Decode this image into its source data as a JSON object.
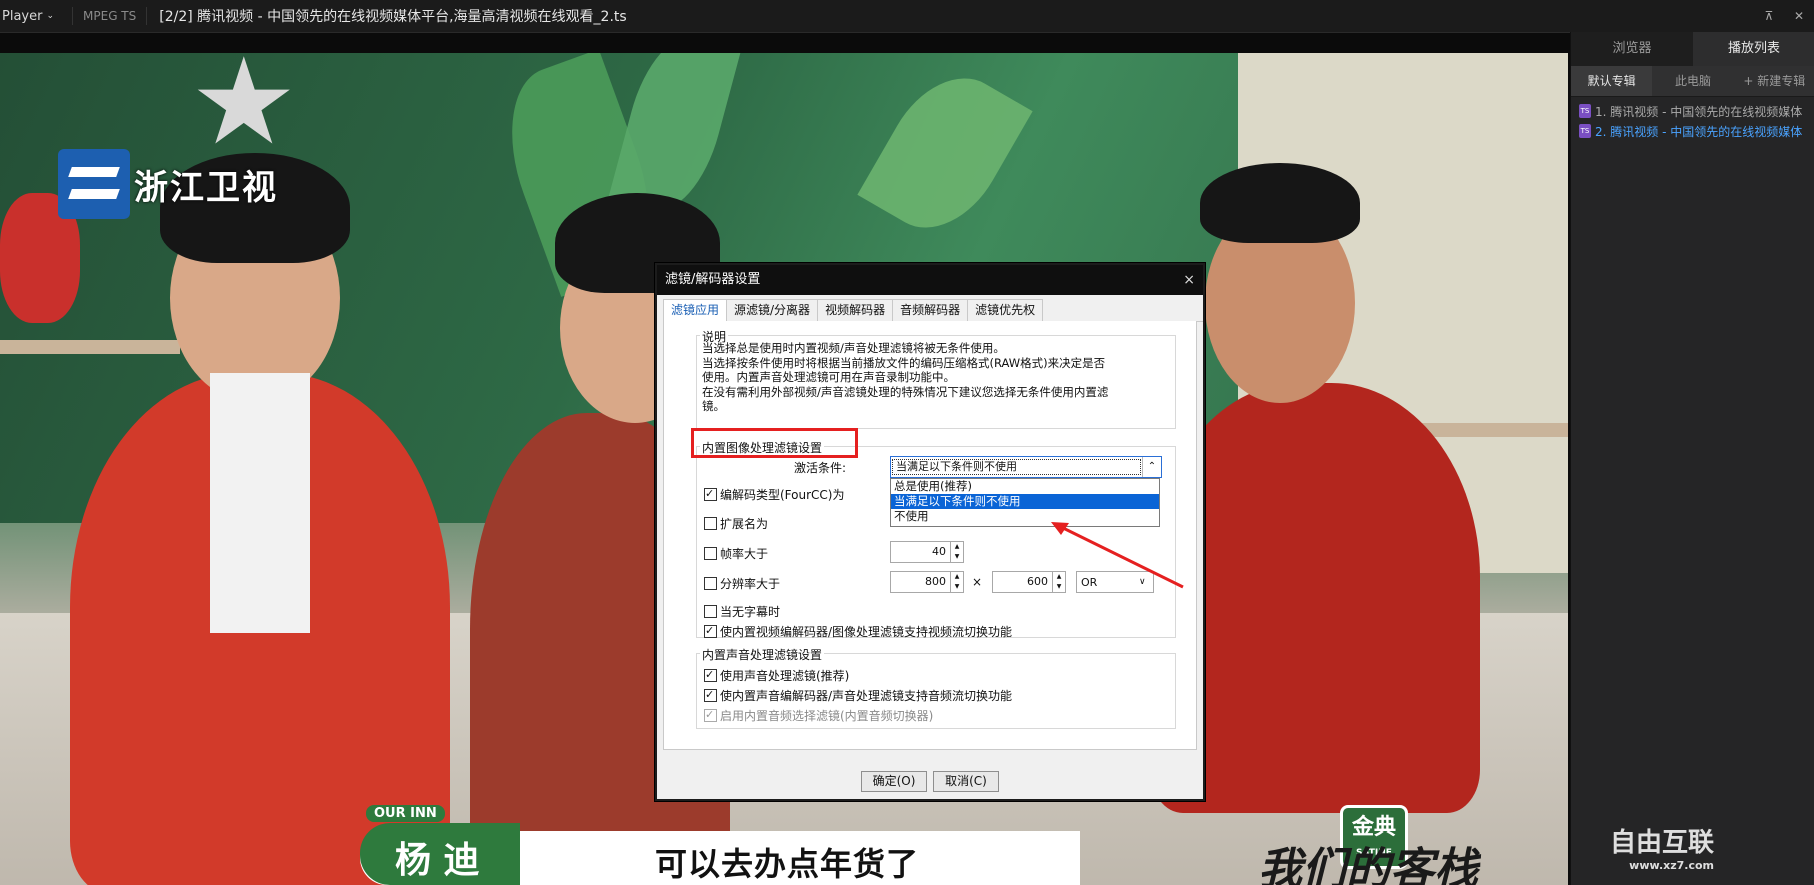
{
  "titlebar": {
    "app_name": "Player",
    "format": "MPEG TS",
    "file_title": "[2/2] 腾讯视频 - 中国领先的在线视频媒体平台,海量高清视频在线观看_2.ts",
    "pin_icon": "pin-icon",
    "close_icon": "close-icon"
  },
  "video": {
    "channel_logo": "浙江卫视",
    "our_inn_tag": "OUR INN",
    "speaker_name": "杨 迪",
    "subtitle": "可以去办点年货了",
    "show_logo": "我们的客栈",
    "sponsor_main": "金典",
    "sponsor_sub": "SATINE"
  },
  "sidebar": {
    "tabs": [
      {
        "label": "浏览器"
      },
      {
        "label": "播放列表"
      }
    ],
    "subtabs": [
      {
        "label": "默认专辑"
      },
      {
        "label": "此电脑"
      },
      {
        "label": "+ 新建专辑"
      }
    ],
    "items": [
      {
        "label": "1. 腾讯视频 - 中国领先的在线视频媒体"
      },
      {
        "label": "2. 腾讯视频 - 中国领先的在线视频媒体"
      }
    ]
  },
  "dialog": {
    "title": "滤镜/解码器设置",
    "close": "×",
    "tabs": [
      {
        "label": "滤镜应用"
      },
      {
        "label": "源滤镜/分离器"
      },
      {
        "label": "视频解码器"
      },
      {
        "label": "音频解码器"
      },
      {
        "label": "滤镜优先权"
      }
    ],
    "desc_legend": "说明",
    "desc_lines": [
      "当选择总是使用时内置视频/声音处理滤镜将被无条件使用。",
      "当选择按条件使用时将根据当前播放文件的编码压缩格式(RAW格式)来决定是否",
      "使用。内置声音处理滤镜可用在声音录制功能中。",
      "在没有需利用外部视频/声音滤镜处理的特殊情况下建议您选择无条件使用内置滤",
      "镜。"
    ],
    "image_legend": "内置图像处理滤镜设置",
    "activation_label": "激活条件:",
    "activation_value": "当满足以下条件则不使用",
    "dropdown_options": [
      {
        "label": "总是使用(推荐)"
      },
      {
        "label": "当满足以下条件则不使用"
      },
      {
        "label": "不使用"
      }
    ],
    "cb_fourcc": "编解码类型(FourCC)为",
    "cb_ext": "扩展名为",
    "cb_framerate": "帧率大于",
    "framerate_value": "40",
    "cb_resolution": "分辨率大于",
    "res_w": "800",
    "res_x": "×",
    "res_h": "600",
    "res_op": "OR",
    "cb_nosub": "当无字幕时",
    "cb_video_switch": "使内置视频编解码器/图像处理滤镜支持视频流切换功能",
    "audio_legend": "内置声音处理滤镜设置",
    "cb_audio_filter": "使用声音处理滤镜(推荐)",
    "cb_audio_switch": "使内置声音编解码器/声音处理滤镜支持音频流切换功能",
    "cb_audio_selector": "启用内置音频选择滤镜(内置音频切换器)",
    "ok": "确定(O)",
    "cancel": "取消(C)"
  },
  "watermark": {
    "main": "自由互联",
    "sub": "www.xz7.com"
  }
}
